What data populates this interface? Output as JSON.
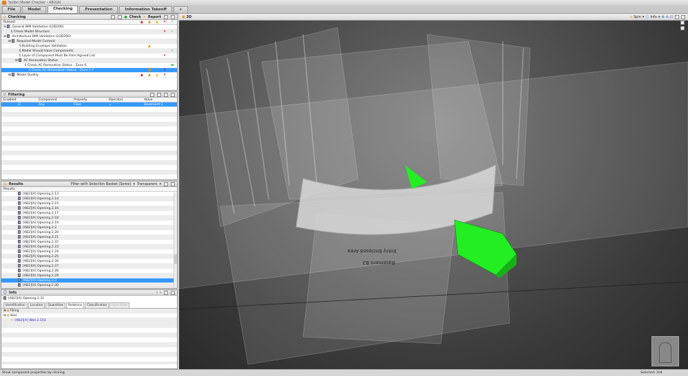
{
  "window": {
    "title": "Solibri Model Checker - AB2(A)"
  },
  "tabs": [
    {
      "label": "File"
    },
    {
      "label": "Model"
    },
    {
      "label": "Checking"
    },
    {
      "label": "Presentation"
    },
    {
      "label": "Information Takeoff"
    },
    {
      "label": "+"
    }
  ],
  "checking": {
    "title": "Checking",
    "check_label": "Check",
    "report_label": "Report",
    "column": "Ruleset",
    "rows": [
      {
        "label": "General BIM Validation (LOD200)",
        "indent": 0,
        "icons": [
          "",
          "",
          "",
          "",
          "",
          "",
          ""
        ]
      },
      {
        "label": "Check Model Structure",
        "indent": 1,
        "icons": [
          "",
          "",
          "",
          "○",
          "",
          "○",
          "✕",
          "✓"
        ]
      },
      {
        "label": "Architecture BIM Validation (LOD200)",
        "indent": 0
      },
      {
        "label": "Required Model Content",
        "indent": 1
      },
      {
        "label": "Building Envelope Validation",
        "indent": 2
      },
      {
        "label": "Model Should Have Components",
        "indent": 2
      },
      {
        "label": "Layer of Component Must Be from Agreed List",
        "indent": 2
      },
      {
        "label": "AC Renovation Status",
        "indent": 2
      },
      {
        "label": "Check AC Renovation Status - Zone 6",
        "indent": 3
      },
      {
        "label": "Check AC Renovation Status - Zone 1-7",
        "indent": 3,
        "selected": true
      },
      {
        "label": "Model Quality",
        "indent": 1
      }
    ]
  },
  "filtering": {
    "title": "Filtering",
    "columns": [
      "Enabled",
      "Component",
      "Property",
      "Operator",
      "Value"
    ],
    "rows": [
      {
        "enabled": "☑",
        "component": "Any",
        "property": "Floor",
        "operator": "=",
        "value": "Basement 2"
      }
    ]
  },
  "results": {
    "title": "Results",
    "filter_label": "Filter with Selection Basket (Some)",
    "mode_label": "Transparent",
    "column": "Results",
    "items": [
      "[AB2][A] Opening.2.13",
      "[AB2][A] Opening.2.14",
      "[AB2][A] Opening.2.15",
      "[AB2][A] Opening.2.16",
      "[AB2][A] Opening.2.17",
      "[AB2][A] Opening.2.18",
      "[AB2][A] Opening.2.19",
      "[AB2][A] Opening.2.2",
      "[AB2][A] Opening.2.20",
      "[AB2][A] Opening.2.21",
      "[AB2][A] Opening.2.22",
      "[AB2][A] Opening.2.23",
      "[AB2][A] Opening.2.24",
      "[AB2][A] Opening.2.25",
      "[AB2][A] Opening.2.26",
      "[AB2][A] Opening.2.27",
      "[AB2][A] Opening.2.28",
      "[AB2][A] Opening.2.29",
      "[AB2][A] Opening.2.3",
      "[AB2][A] Opening.2.30"
    ],
    "selected_index": 18
  },
  "info": {
    "title": "Info",
    "component": "[AB2][A] Opening.2.31",
    "tabs": [
      "Identification",
      "Location",
      "Quantities",
      "Relations",
      "Classification",
      "Hyperlinks"
    ],
    "active_tab": "Relations",
    "tree": [
      {
        "label": "Filling"
      },
      {
        "label": "Void"
      },
      {
        "label": "[AB2][A] Wall.2.103"
      }
    ]
  },
  "view3d": {
    "title": "3D",
    "spin_label": "Spin",
    "info_label": "Info",
    "labels": [
      "Entry Enclosed Area",
      "Basement B2"
    ]
  },
  "status": {
    "hint": "Show component properties by clicking.",
    "selected": "Selected: 104"
  },
  "colors": {
    "selection": "#3399ff",
    "highlight": "#22ee22"
  }
}
